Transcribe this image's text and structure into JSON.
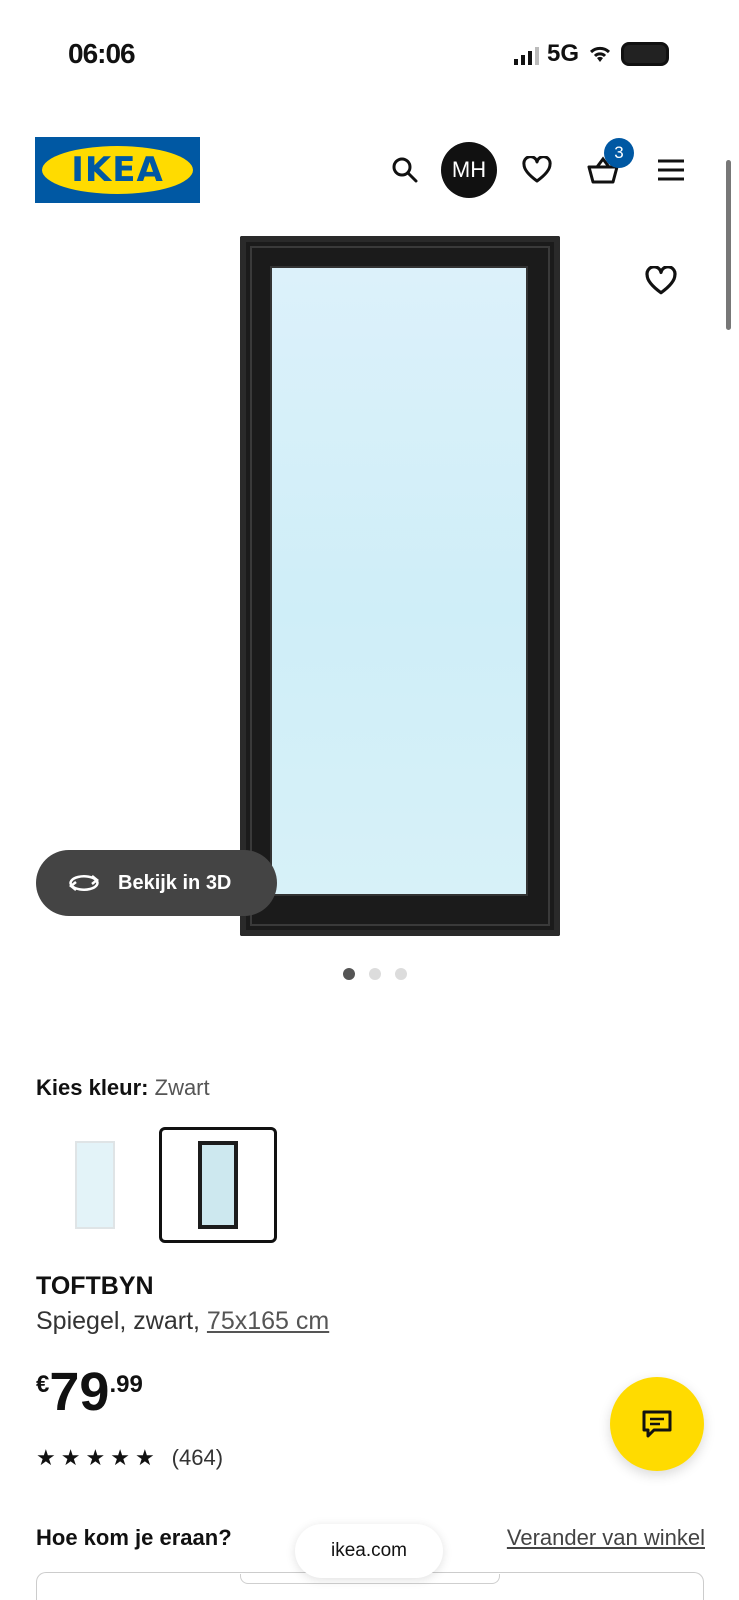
{
  "status_bar": {
    "time": "06:06",
    "network": "5G"
  },
  "header": {
    "logo_text": "IKEA",
    "avatar_initials": "MH",
    "basket_count": "3"
  },
  "product_gallery": {
    "view_3d_label": "Bekijk in 3D",
    "image_count": 3,
    "active_image": 1
  },
  "colour": {
    "label": "Kies kleur:",
    "selected": "Zwart"
  },
  "product": {
    "name": "TOFTBYN",
    "description_prefix": "Spiegel, zwart,",
    "size": "75x165 cm",
    "price_currency": "€",
    "price_integer": "79",
    "price_decimal": ".99",
    "rating_stars": 5,
    "review_count": "(464)"
  },
  "delivery": {
    "title": "Hoe kom je eraan?",
    "change_store": "Verander van winkel"
  },
  "browser": {
    "url": "ikea.com"
  },
  "colors": {
    "ikea_blue": "#0058a3",
    "ikea_yellow": "#ffdb00"
  }
}
